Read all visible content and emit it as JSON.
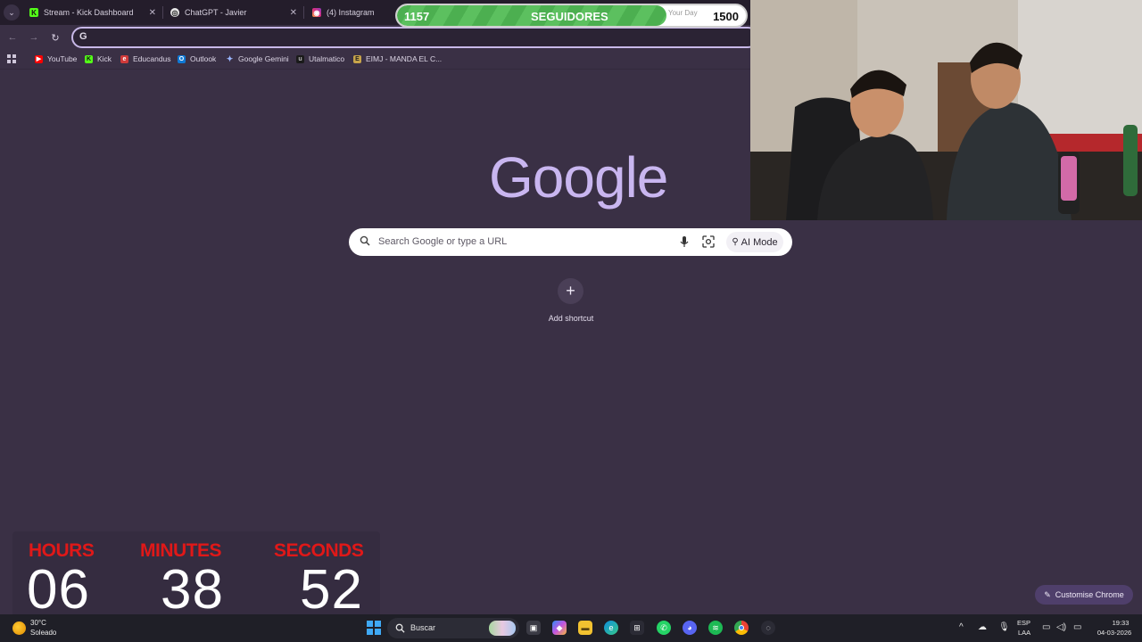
{
  "tabs": [
    {
      "label": "Stream - Kick Dashboard",
      "favicon": "kick-icon"
    },
    {
      "label": "ChatGPT - Javier",
      "favicon": "chatgpt-icon"
    },
    {
      "label": "(4) Instagram",
      "favicon": "instagram-icon"
    }
  ],
  "omnibox": {
    "prefix": "G"
  },
  "bookmarks": [
    {
      "label": "YouTube"
    },
    {
      "label": "Kick"
    },
    {
      "label": "Educandus"
    },
    {
      "label": "Outlook"
    },
    {
      "label": "Google Gemini"
    },
    {
      "label": "Utalmatico"
    },
    {
      "label": "EIMJ - MANDA EL C..."
    }
  ],
  "ntp": {
    "logo": "Google",
    "search_placeholder": "Search Google or type a URL",
    "ai_mode": "AI Mode",
    "add_shortcut": "Add shortcut",
    "customise": "Customise Chrome"
  },
  "goal": {
    "current": "1157",
    "label": "SEGUIDORES",
    "subtitle": "Your Day",
    "target": "1500",
    "progress_fraction": 0.7713
  },
  "timer": {
    "hours_label": "HOURS",
    "hours": "06",
    "minutes_label": "MINUTES",
    "minutes": "38",
    "seconds_label": "SECONDS",
    "seconds": "52"
  },
  "taskbar": {
    "temp": "30°C",
    "weather": "Soleado",
    "search": "Buscar",
    "lang_top": "ESP",
    "lang_bottom": "LAA",
    "time": "19:33",
    "date": "04-03-2026"
  },
  "colors": {
    "accent": "#c9b6f0",
    "timer_label": "#e01818",
    "goal_fill": "#4caf50"
  }
}
